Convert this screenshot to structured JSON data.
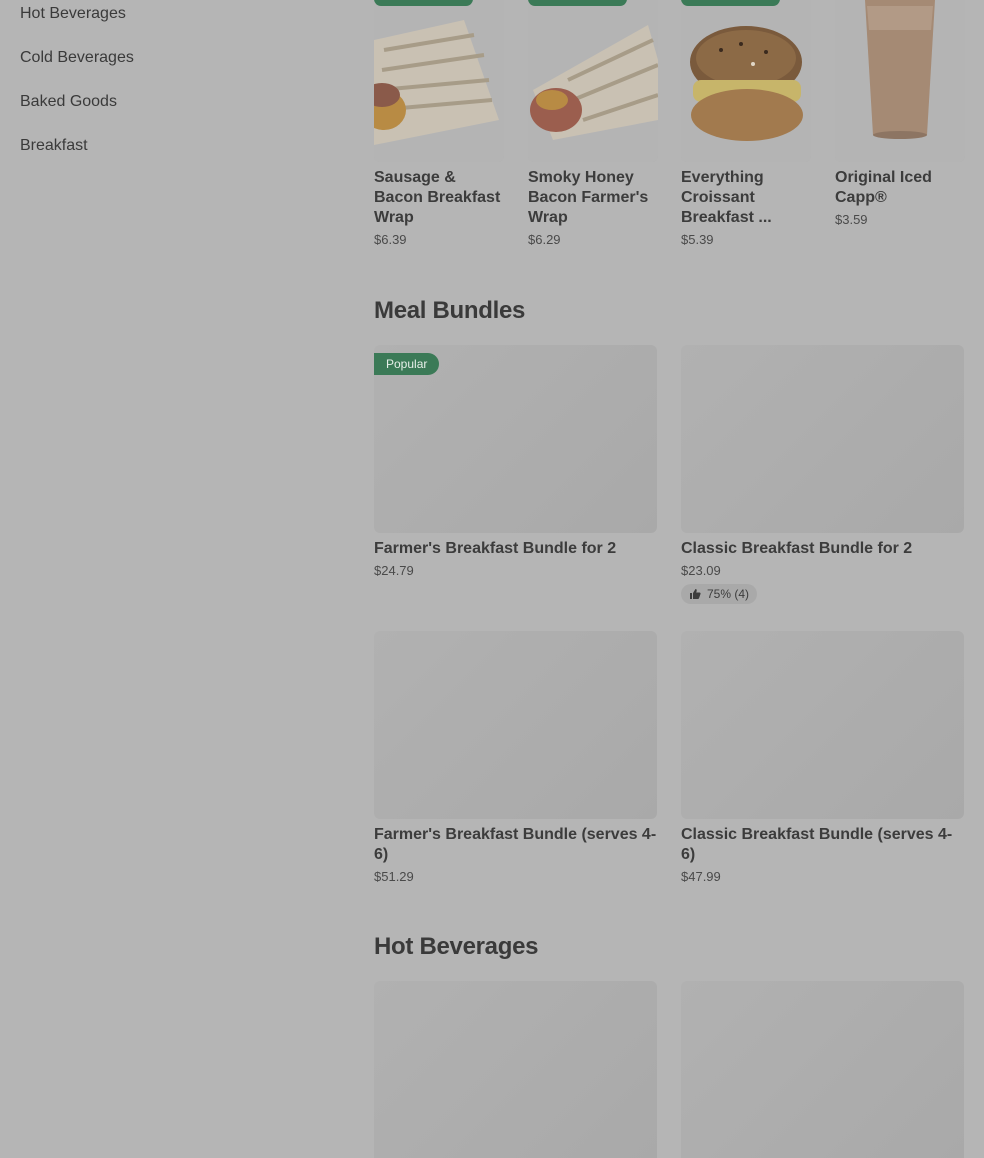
{
  "sidebar": {
    "items": [
      {
        "label": "Hot Beverages"
      },
      {
        "label": "Cold Beverages"
      },
      {
        "label": "Baked Goods"
      },
      {
        "label": "Breakfast"
      }
    ]
  },
  "top_row": {
    "items": [
      {
        "name": "Sausage & Bacon Breakfast Wrap",
        "price": "$6.39"
      },
      {
        "name": "Smoky Honey Bacon Farmer's Wrap",
        "price": "$6.29"
      },
      {
        "name": "Everything Croissant Breakfast ...",
        "price": "$5.39"
      },
      {
        "name": "Original Iced Capp®",
        "price": "$3.59"
      }
    ]
  },
  "meal_bundles": {
    "title": "Meal Bundles",
    "items": [
      {
        "name": "Farmer's Breakfast Bundle for 2",
        "price": "$24.79",
        "badge": "Popular"
      },
      {
        "name": "Classic Breakfast Bundle for 2",
        "price": "$23.09",
        "rating": "75% (4)"
      },
      {
        "name": "Farmer's Breakfast Bundle (serves 4-6)",
        "price": "$51.29"
      },
      {
        "name": "Classic Breakfast Bundle (serves 4-6)",
        "price": "$47.99"
      }
    ]
  },
  "hot_beverages": {
    "title": "Hot Beverages"
  },
  "colors": {
    "overlay_background": "#b5b5b5",
    "badge_green": "#3b7a57"
  }
}
